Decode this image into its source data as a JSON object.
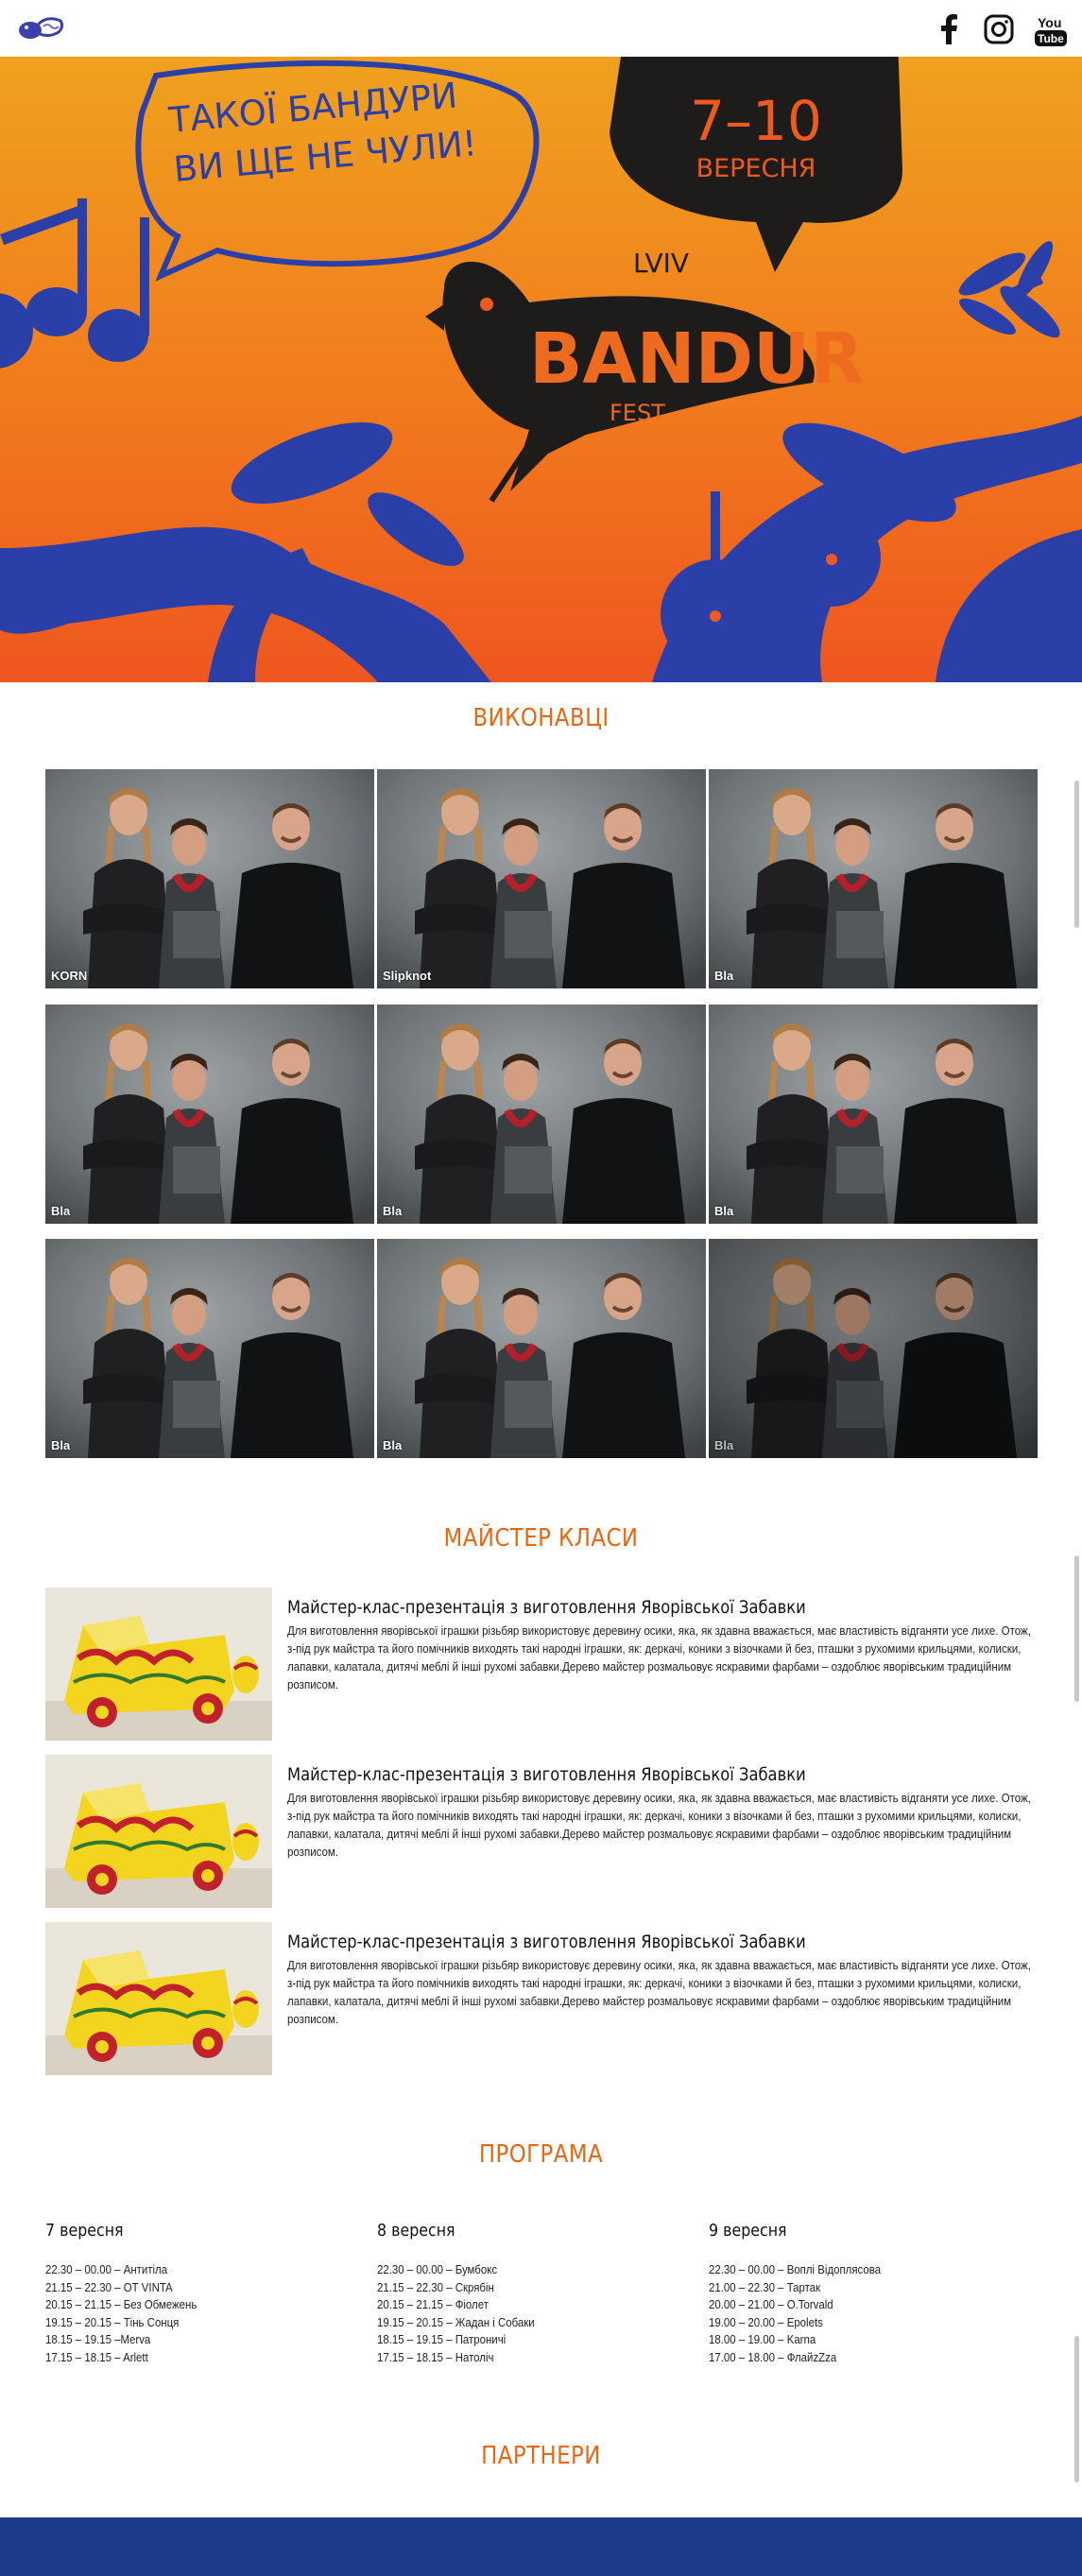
{
  "header": {
    "logo_icon": "bandur-fest-bird-logo",
    "social": [
      {
        "name": "facebook-icon"
      },
      {
        "name": "instagram-icon"
      },
      {
        "name": "youtube-icon",
        "label": "You Tube"
      }
    ]
  },
  "hero": {
    "speech_line1": "ТАКОЇ БАНДУРИ",
    "speech_line2": "ВИ ЩЕ НЕ ЧУЛИ!",
    "dates": "7–10",
    "month": "ВЕРЕСНЯ",
    "logo_city": "LVIV",
    "logo_name": "BANDUR",
    "logo_suffix": "FEST",
    "colors": {
      "orange_top": "#f0a11f",
      "orange_bottom": "#ee5a1e",
      "blue": "#2b3fa8",
      "dark": "#1d1c1a"
    }
  },
  "performers": {
    "title": "ВИКОНАВЦІ",
    "items": [
      {
        "label": "KORN"
      },
      {
        "label": "Slipknot"
      },
      {
        "label": "Bla"
      },
      {
        "label": "Bla"
      },
      {
        "label": "Bla"
      },
      {
        "label": "Bla"
      },
      {
        "label": "Bla"
      },
      {
        "label": "Bla"
      },
      {
        "label": "Bla"
      }
    ]
  },
  "masterclasses": {
    "title": "МАЙСТЕР КЛАСИ",
    "items": [
      {
        "title": "Майстер-клас-презентація з виготовлення Яворівської Забавки",
        "text": "Для виготовлення яворівської іграшки різьбяр використовує деревину осики, яка, як здавна вважається, має властивість відганяти усе лихе. Отож, з-під рук майстра та його помічників виходять такі народні іграшки, як: деркачі, коники з візочками й без, пташки з рухомими крильцями, колиски, лапавки, калатала, дитячі меблі й інші рухомі забавки.Дерево майстер розмальовує яскравими фарбами – оздоблює яворівським традиційним розписом."
      },
      {
        "title": "Майстер-клас-презентація з виготовлення Яворівської Забавки",
        "text": "Для виготовлення яворівської іграшки різьбяр використовує деревину осики, яка, як здавна вважається, має властивість відганяти усе лихе. Отож, з-під рук майстра та його помічників виходять такі народні іграшки, як: деркачі, коники з візочками й без, пташки з рухомими крильцями, колиски, лапавки, калатала, дитячі меблі й інші рухомі забавки.Дерево майстер розмальовує яскравими фарбами – оздоблює яворівським традиційним розписом."
      },
      {
        "title": "Майстер-клас-презентація з виготовлення Яворівської Забавки",
        "text": "Для виготовлення яворівської іграшки різьбяр використовує деревину осики, яка, як здавна вважається, має властивість відганяти усе лихе. Отож, з-під рук майстра та його помічників виходять такі народні іграшки, як: деркачі, коники з візочками й без, пташки з рухомими крильцями, колиски, лапавки, калатала, дитячі меблі й інші рухомі забавки.Дерево майстер розмальовує яскравими фарбами – оздоблює яворівським традиційним розписом."
      }
    ]
  },
  "program": {
    "title": "ПРОГРАМА",
    "days": [
      {
        "title": "7 вересня",
        "items": [
          "22.30 – 00.00 – Антитіла",
          "21.15 – 22.30 – ОТ VINTA",
          "20.15 – 21.15 – Без Обмежень",
          "19.15 – 20.15 – Тінь Сонця",
          "18.15 – 19.15 –Merva",
          "17.15 – 18.15 – Arlett"
        ]
      },
      {
        "title": "8 вересня",
        "items": [
          "22.30 – 00.00 – Бумбокс",
          "21.15 – 22.30 – Скрябін",
          "20.15 – 21.15 – Фіолет",
          "19.15 – 20.15 – Жадан і Собаки",
          "18.15 – 19.15 – Патроничі",
          "17.15 – 18.15 – Натоліч"
        ]
      },
      {
        "title": "9 вересня",
        "items": [
          "22.30 – 00.00 – Воплі Відоплясова",
          "21.00 – 22.30 – Тартак",
          "20.00 – 21.00 – O.Torvald",
          "19.00 – 20.00 – Epolets",
          "18.00 – 19.00 – Karna",
          "17.00 – 18.00 – ФлайzZza"
        ]
      }
    ]
  },
  "partners": {
    "title": "ПАРТНЕРИ",
    "band_color": "#1e3a8a"
  }
}
